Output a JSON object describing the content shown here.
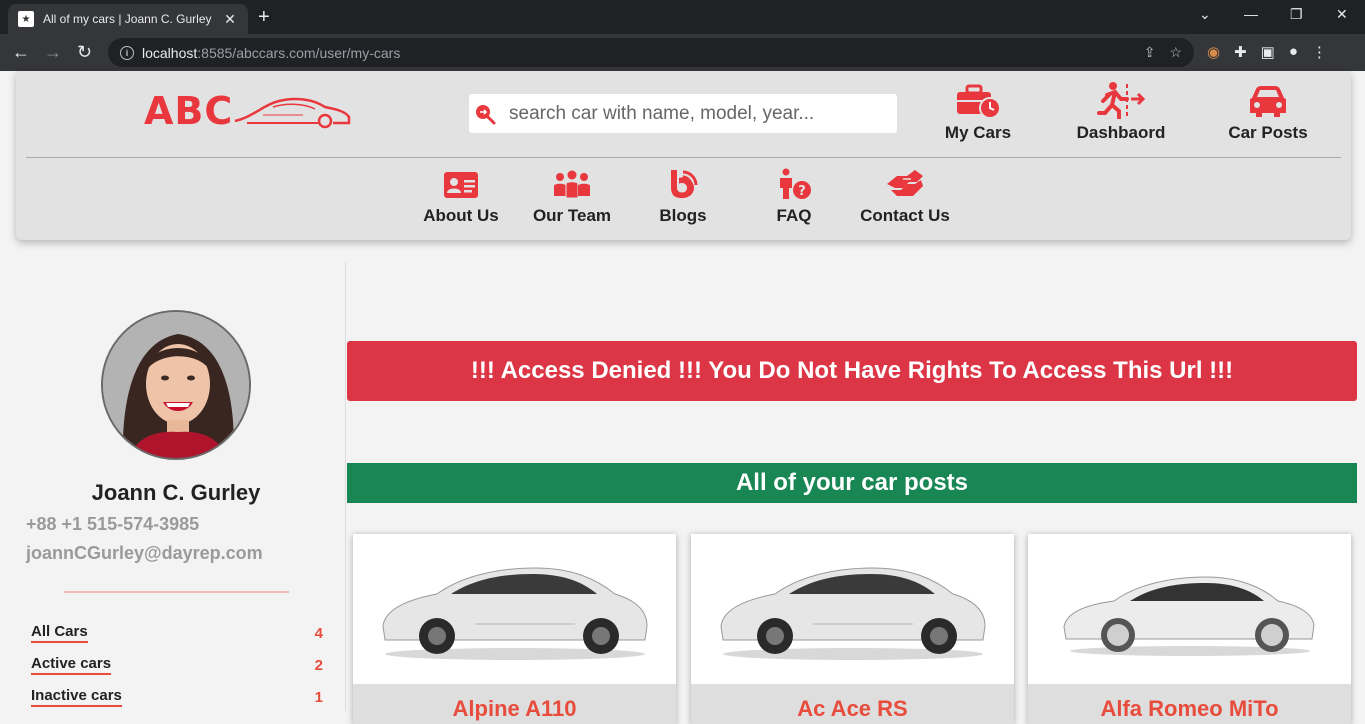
{
  "browser": {
    "tab_title": "All of my cars | Joann C. Gurley",
    "url_host": "localhost",
    "url_rest": ":8585/abccars.com/user/my-cars"
  },
  "header": {
    "logo_text": "ABC",
    "search_placeholder": "search car with name, model, year...",
    "top_nav": [
      {
        "label": "My Cars",
        "icon": "briefcase-clock-icon"
      },
      {
        "label": "Dashbaord",
        "icon": "running-exit-icon"
      },
      {
        "label": "Car Posts",
        "icon": "car-icon"
      }
    ],
    "sub_nav": [
      {
        "label": "About Us",
        "icon": "id-card-icon"
      },
      {
        "label": "Our Team",
        "icon": "team-icon"
      },
      {
        "label": "Blogs",
        "icon": "blog-icon"
      },
      {
        "label": "FAQ",
        "icon": "person-question-icon"
      },
      {
        "label": "Contact Us",
        "icon": "handshake-icon"
      }
    ],
    "accent_color": "#e8383d"
  },
  "profile": {
    "name": "Joann C. Gurley",
    "phone": "+88 +1 515-574-3985",
    "email": "joannCGurley@dayrep.com"
  },
  "sidebar": {
    "items": [
      {
        "label": "All Cars",
        "count": "4"
      },
      {
        "label": "Active cars",
        "count": "2"
      },
      {
        "label": "Inactive cars",
        "count": "1"
      }
    ]
  },
  "main": {
    "alert": "!!! Access Denied !!! You Do Not Have Rights To Access This Url !!!",
    "section_title": "All of your car posts",
    "cards": [
      {
        "title": "Alpine A110"
      },
      {
        "title": "Ac Ace RS"
      },
      {
        "title": "Alfa Romeo MiTo"
      }
    ]
  }
}
